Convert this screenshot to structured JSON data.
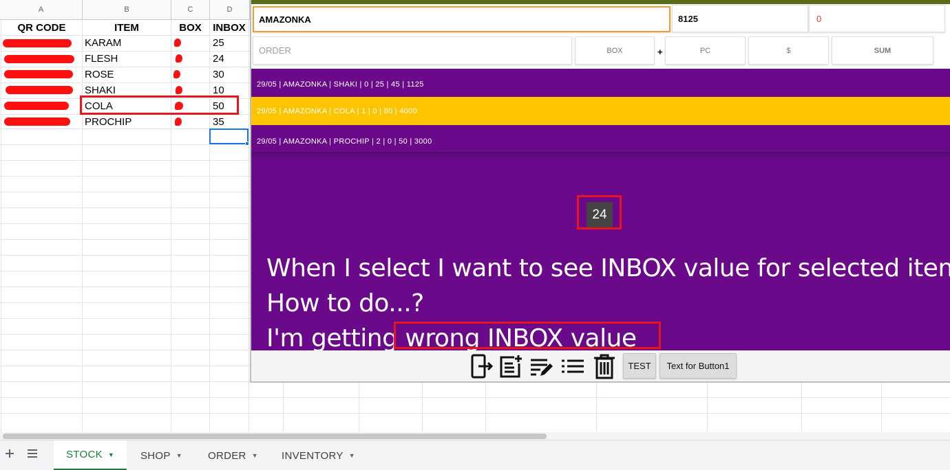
{
  "sheet": {
    "col_letters": [
      "A",
      "B",
      "C",
      "D"
    ],
    "headers": [
      "QR CODE",
      "ITEM",
      "BOX",
      "INBOX"
    ],
    "rows": [
      {
        "item": "KARAM",
        "inbox": "25"
      },
      {
        "item": "FLESH",
        "inbox": "24"
      },
      {
        "item": "ROSE",
        "inbox": "30"
      },
      {
        "item": "SHAKI",
        "inbox": "10"
      },
      {
        "item": "COLA",
        "inbox": "50"
      },
      {
        "item": "PROCHIP",
        "inbox": "35"
      }
    ],
    "tabs": [
      {
        "label": "STOCK",
        "active": true
      },
      {
        "label": "SHOP",
        "active": false
      },
      {
        "label": "ORDER",
        "active": false
      },
      {
        "label": "INVENTORY",
        "active": false
      }
    ],
    "icons": {
      "add": "plus-icon",
      "all_sheets": "list-icon"
    }
  },
  "app": {
    "customer": "AMAZONKA",
    "code": "8125",
    "zero": "0",
    "order_placeholder": "ORDER",
    "box_label": "BOX",
    "plus": "+",
    "pc_label": "PC",
    "dollar_label": "$",
    "sum_label": "SUM",
    "list": [
      {
        "text": "29/05  |  AMAZONKA  |  SHAKI  |  0  |  25  |  45  |  1125",
        "selected": false
      },
      {
        "text": "29/05  |  AMAZONKA  |  COLA  |  1  |  0  |  80  |  4000",
        "selected": true
      },
      {
        "text": "29/05  |  AMAZONKA  |  PROCHIP  |  2  |  0  |  50  |  3000",
        "selected": false
      }
    ],
    "inbox_value": "24",
    "note": [
      "When I select I want to see INBOX value for selected item.",
      "How to do...?",
      "I'm getting wrong INBOX value"
    ],
    "toolbar": {
      "icons": [
        "export-icon",
        "add-note-icon",
        "edit-list-icon",
        "list-icon",
        "trash-icon"
      ],
      "test_label": "TEST",
      "button1_label": "Text for Button1"
    }
  },
  "colors": {
    "list_bg": "#6a0a8a",
    "selected_row": "#ffc400",
    "annotation": "#e8141e",
    "active_tab": "#188038",
    "focus_border": "#f39b2f"
  }
}
